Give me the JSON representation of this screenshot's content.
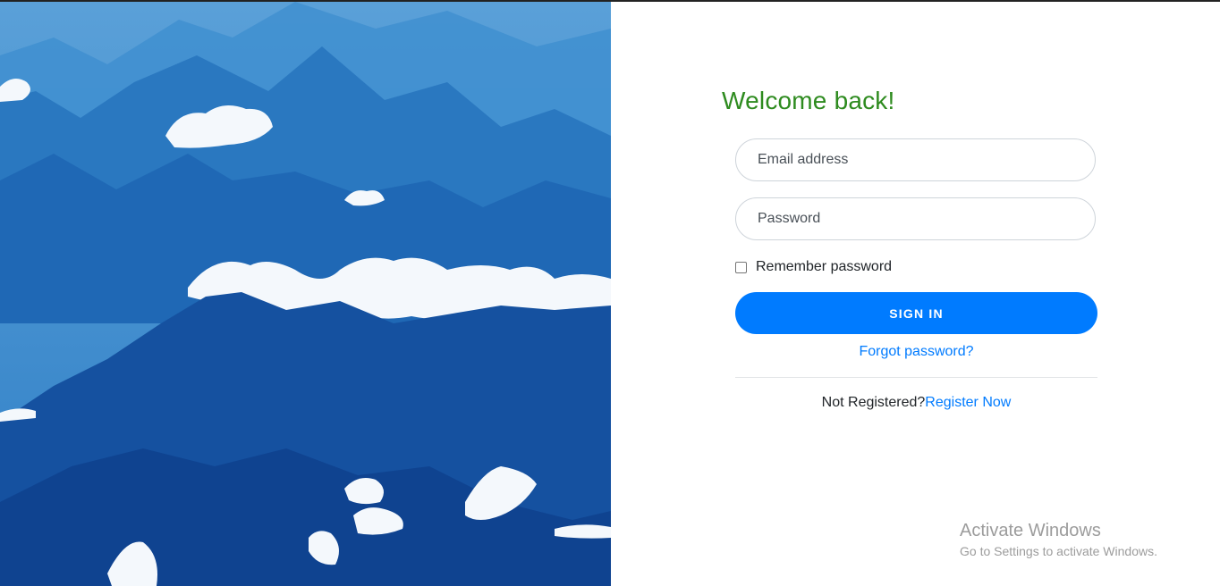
{
  "hero": {
    "image": "blue-mountains-with-clouds"
  },
  "login": {
    "heading": "Welcome back!",
    "heading_color": "#2e8b1f",
    "email_placeholder": "Email address",
    "email_value": "",
    "password_placeholder": "Password",
    "password_value": "",
    "remember_label": "Remember password",
    "remember_checked": false,
    "signin_label": "SIGN IN",
    "accent_color": "#007bff",
    "forgot_label": "Forgot password?",
    "not_registered_text": "Not Registered?",
    "register_label": "Register Now"
  },
  "watermark": {
    "title": "Activate Windows",
    "subtitle": "Go to Settings to activate Windows."
  }
}
